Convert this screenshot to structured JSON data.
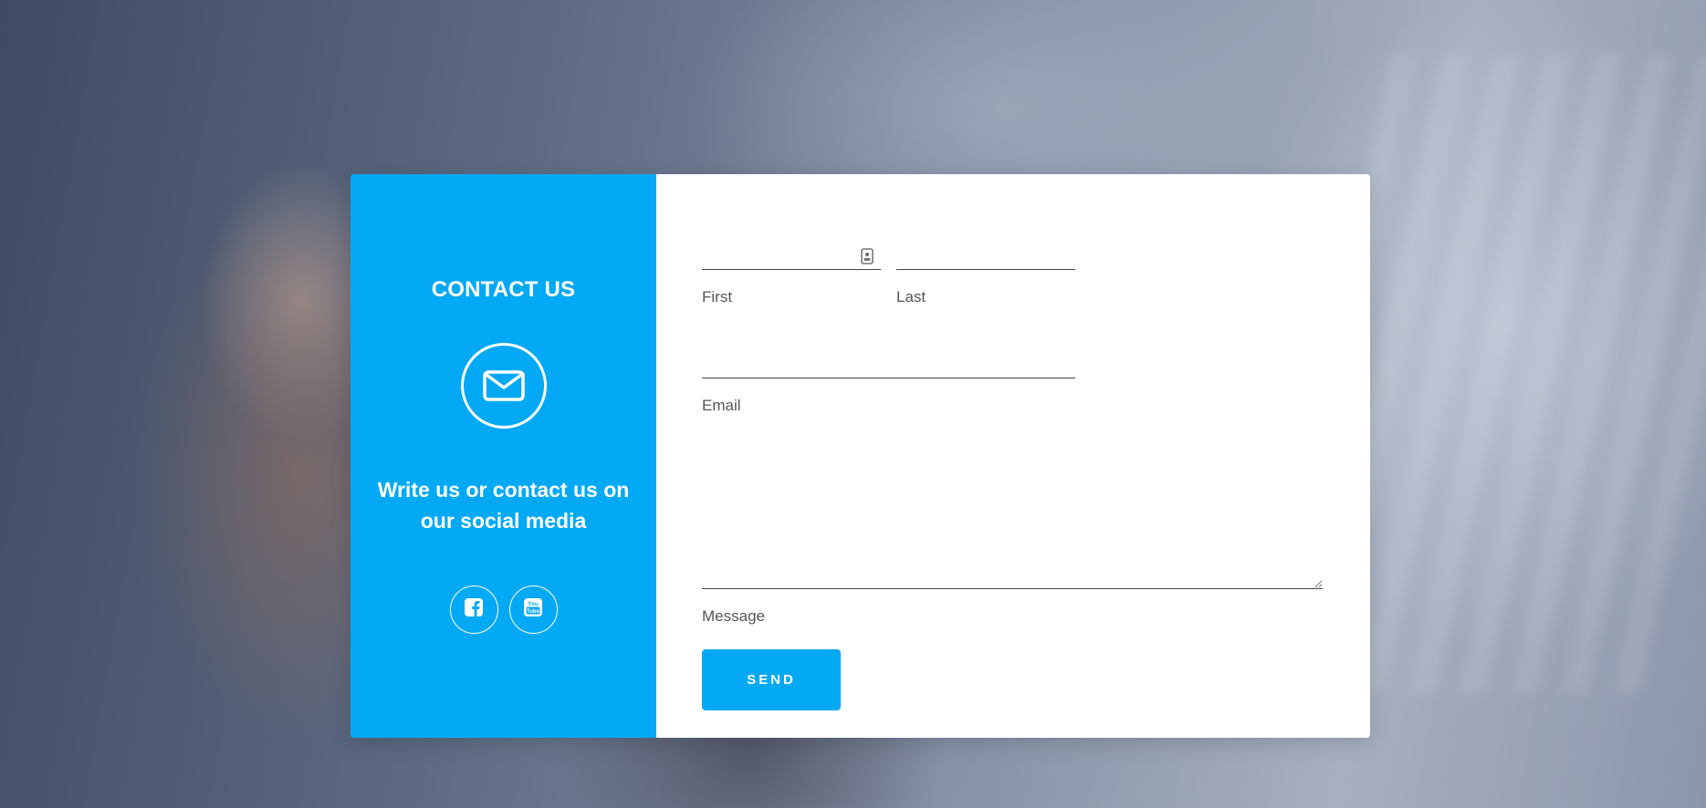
{
  "contact_panel": {
    "title": "CONTACT US",
    "tagline": "Write us or contact us on our social media",
    "icon": "envelope-icon",
    "socials": [
      {
        "name": "facebook",
        "icon": "facebook-icon"
      },
      {
        "name": "youtube",
        "icon": "youtube-icon"
      }
    ],
    "accent_color": "#03a9f4"
  },
  "form": {
    "first": {
      "label": "First",
      "value": ""
    },
    "last": {
      "label": "Last",
      "value": ""
    },
    "email": {
      "label": "Email",
      "value": ""
    },
    "message": {
      "label": "Message",
      "value": ""
    },
    "send_label": "SEND"
  }
}
